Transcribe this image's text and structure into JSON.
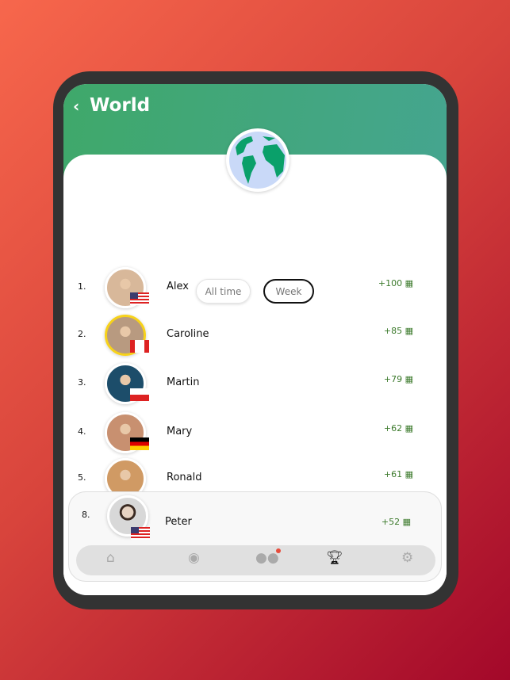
{
  "header": {
    "back_icon": "chevron-left-icon",
    "title": "World"
  },
  "filters": [
    {
      "label": "All time",
      "selected": false
    },
    {
      "label": "Week",
      "selected": true
    }
  ],
  "leaderboard": [
    {
      "rank": "1.",
      "name": "Alex",
      "points": "+100",
      "flag": "us",
      "ring": "#ffffff"
    },
    {
      "rank": "2.",
      "name": "Caroline",
      "points": "+85",
      "flag": "ca",
      "ring": "#f7d21a"
    },
    {
      "rank": "3.",
      "name": "Martin",
      "points": "+79",
      "flag": "pl",
      "ring": "#ffffff"
    },
    {
      "rank": "4.",
      "name": "Mary",
      "points": "+62",
      "flag": "de",
      "ring": "#ffffff"
    },
    {
      "rank": "5.",
      "name": "Ronald",
      "points": "+61",
      "flag": "",
      "ring": "#ffffff"
    }
  ],
  "current_user": {
    "rank": "8.",
    "name": "Peter",
    "points": "+52",
    "flag": "us"
  },
  "nav": {
    "items": [
      "home-icon",
      "chat-icon",
      "friends-icon",
      "trophy-icon",
      "settings-icon"
    ],
    "active": "trophy-icon"
  },
  "colors": {
    "points": "#3c7a2c",
    "header": "#3fa86a"
  }
}
